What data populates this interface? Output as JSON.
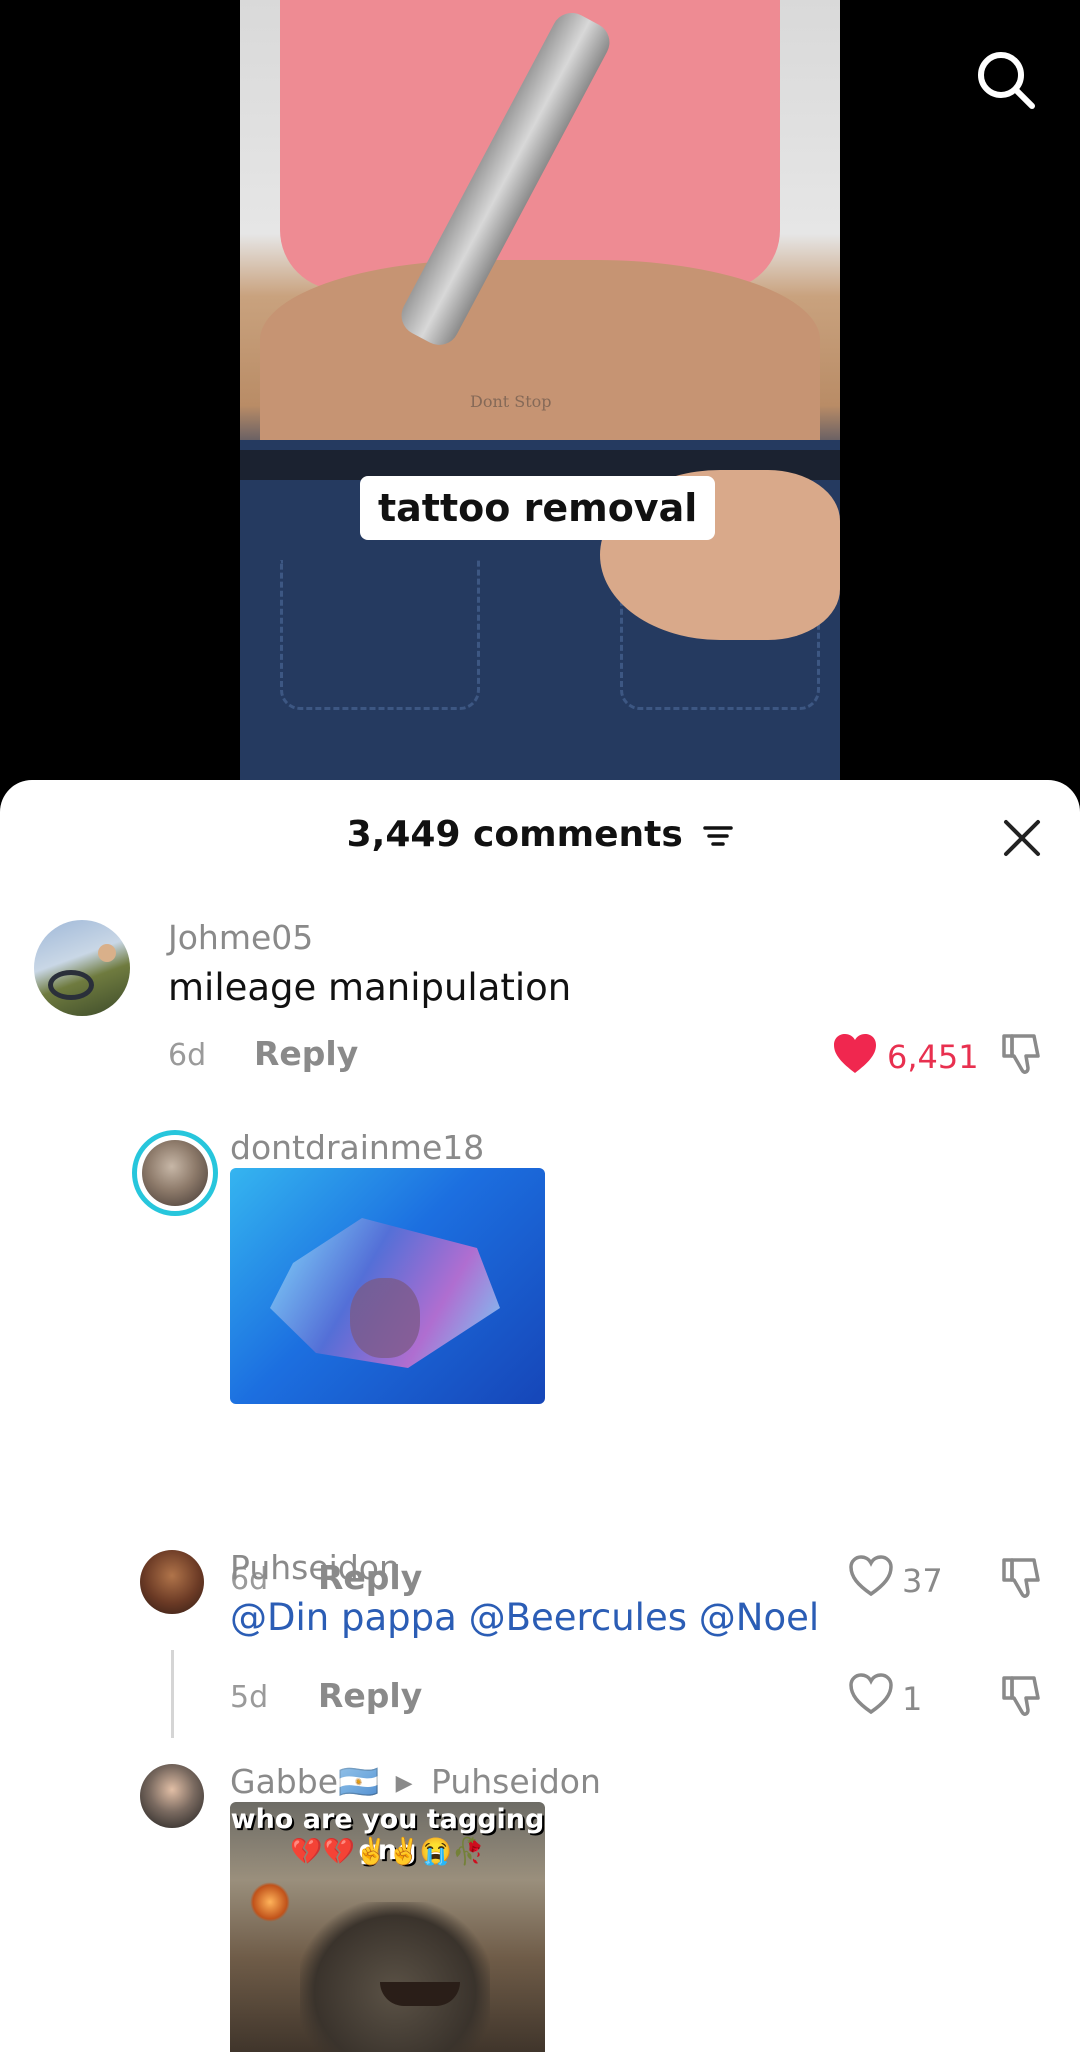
{
  "video": {
    "caption": "tattoo removal",
    "tattoo_text": "Dont Stop"
  },
  "comments_sheet": {
    "count_label": "3,449 comments",
    "comments": [
      {
        "username": "Johme05",
        "text": "mileage manipulation",
        "time": "6d",
        "reply_label": "Reply",
        "likes": "6,451",
        "liked": true
      },
      {
        "username": "dontdrainme18",
        "time": "6d",
        "reply_label": "Reply",
        "likes": "37",
        "liked": false
      },
      {
        "username": "Puhseidon",
        "mentions": [
          "@Din pappa",
          "@Beercules",
          "@Noel"
        ],
        "time": "5d",
        "reply_label": "Reply",
        "likes": "1",
        "liked": false
      },
      {
        "username": "Gabbe🇦🇷",
        "reply_to": "Puhseidon",
        "meme_text": "who are you tagging gng",
        "meme_emoji": "💔💔✌️✌️😭🥀"
      }
    ]
  },
  "colors": {
    "like_red": "#f0274f",
    "mention_blue": "#2b5db5",
    "story_ring": "#27c6dc"
  },
  "icons": {
    "search": "search-icon",
    "close": "close-icon",
    "filter": "filter-icon",
    "heart": "heart-icon",
    "dislike": "thumbs-down-icon"
  }
}
